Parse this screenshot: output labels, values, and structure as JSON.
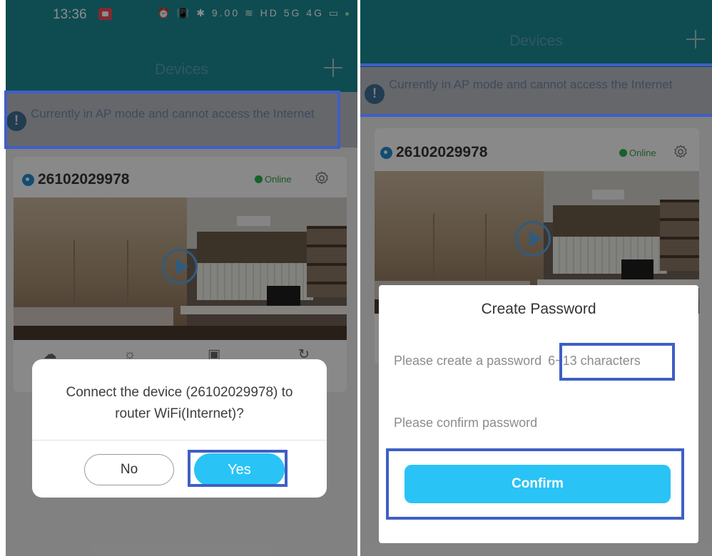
{
  "left_screen": {
    "status_bar": {
      "time": "13:36",
      "icons": "⏰ 📳 ✱ 9.00 ≋ HD 5G 4G ▭"
    },
    "header": {
      "title": "Devices",
      "add_icon": "plus-icon"
    },
    "ap_banner": {
      "icon": "alert-circle-icon",
      "text": "Currently in AP mode and cannot access the Internet"
    },
    "device": {
      "id": "26102029978",
      "status": "Online",
      "settings_icon": "gear-icon"
    },
    "dialog": {
      "message": "Connect the device (26102029978) to router WiFi(Internet)?",
      "no_label": "No",
      "yes_label": "Yes"
    }
  },
  "right_screen": {
    "header": {
      "title": "Devices",
      "add_icon": "plus-icon"
    },
    "ap_banner": {
      "icon": "alert-circle-icon",
      "text": "Currently in AP mode and cannot access the Internet"
    },
    "device": {
      "id": "26102029978",
      "status": "Online",
      "settings_icon": "gear-icon"
    },
    "dialog": {
      "title": "Create Password",
      "password_placeholder": "Please create a password",
      "password_hint": "6~13 characters",
      "confirm_placeholder": "Please confirm password",
      "confirm_label": "Confirm"
    }
  },
  "colors": {
    "header_bg": "#1b8a94",
    "accent_button": "#2ac3f6",
    "highlight_box": "#3f5fc5",
    "online_green": "#28b34b"
  }
}
